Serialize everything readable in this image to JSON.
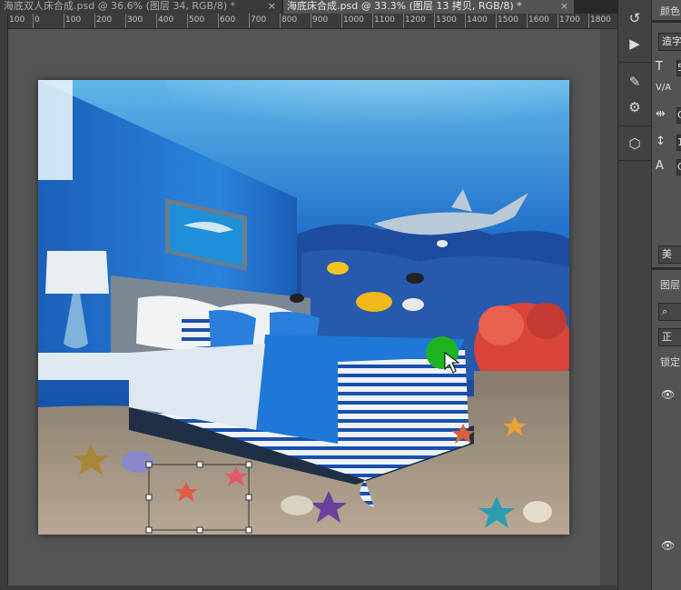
{
  "tabs": [
    {
      "label": "海底双人床合成.psd @ 36.6% (图层 34, RGB/8) *",
      "active": false
    },
    {
      "label": "海底床合成.psd @ 33.3% (图层 13 拷贝, RGB/8) *",
      "active": true
    }
  ],
  "tab_close_glyph": "×",
  "ruler_ticks": [
    "100",
    "0",
    "100",
    "200",
    "300",
    "400",
    "500",
    "600",
    "700",
    "800",
    "900",
    "1000",
    "1100",
    "1200",
    "1300",
    "1400",
    "1500",
    "1600",
    "1700",
    "1800"
  ],
  "tools": [
    {
      "name": "history-icon",
      "glyph": "↺"
    },
    {
      "name": "play-action-icon",
      "glyph": "▶"
    },
    {
      "name": "brush-settings-icon",
      "glyph": "✎"
    },
    {
      "name": "adjustments-icon",
      "glyph": "⚙"
    },
    {
      "name": "3d-cube-icon",
      "glyph": "⬡"
    }
  ],
  "panel": {
    "top_label": "颜色",
    "font_family_value": "造字",
    "font_size_value": "5",
    "tracking_label": "V/A",
    "kerning_value": "C",
    "leading_value": "1",
    "baseline_value": "C",
    "lang_button": "美",
    "layers_tab": "图层",
    "blend_mode": "正",
    "lock_label": "锁定",
    "eye_glyph": "👁"
  },
  "colors": {
    "water_top": "#5fb6e8",
    "water_deep": "#0f3f8f",
    "wall": "#1b63bf",
    "sand": "#a99a87",
    "bed_blue": "#1f78d6",
    "coral": "#d9453a",
    "cursor_green": "#1fb321"
  }
}
